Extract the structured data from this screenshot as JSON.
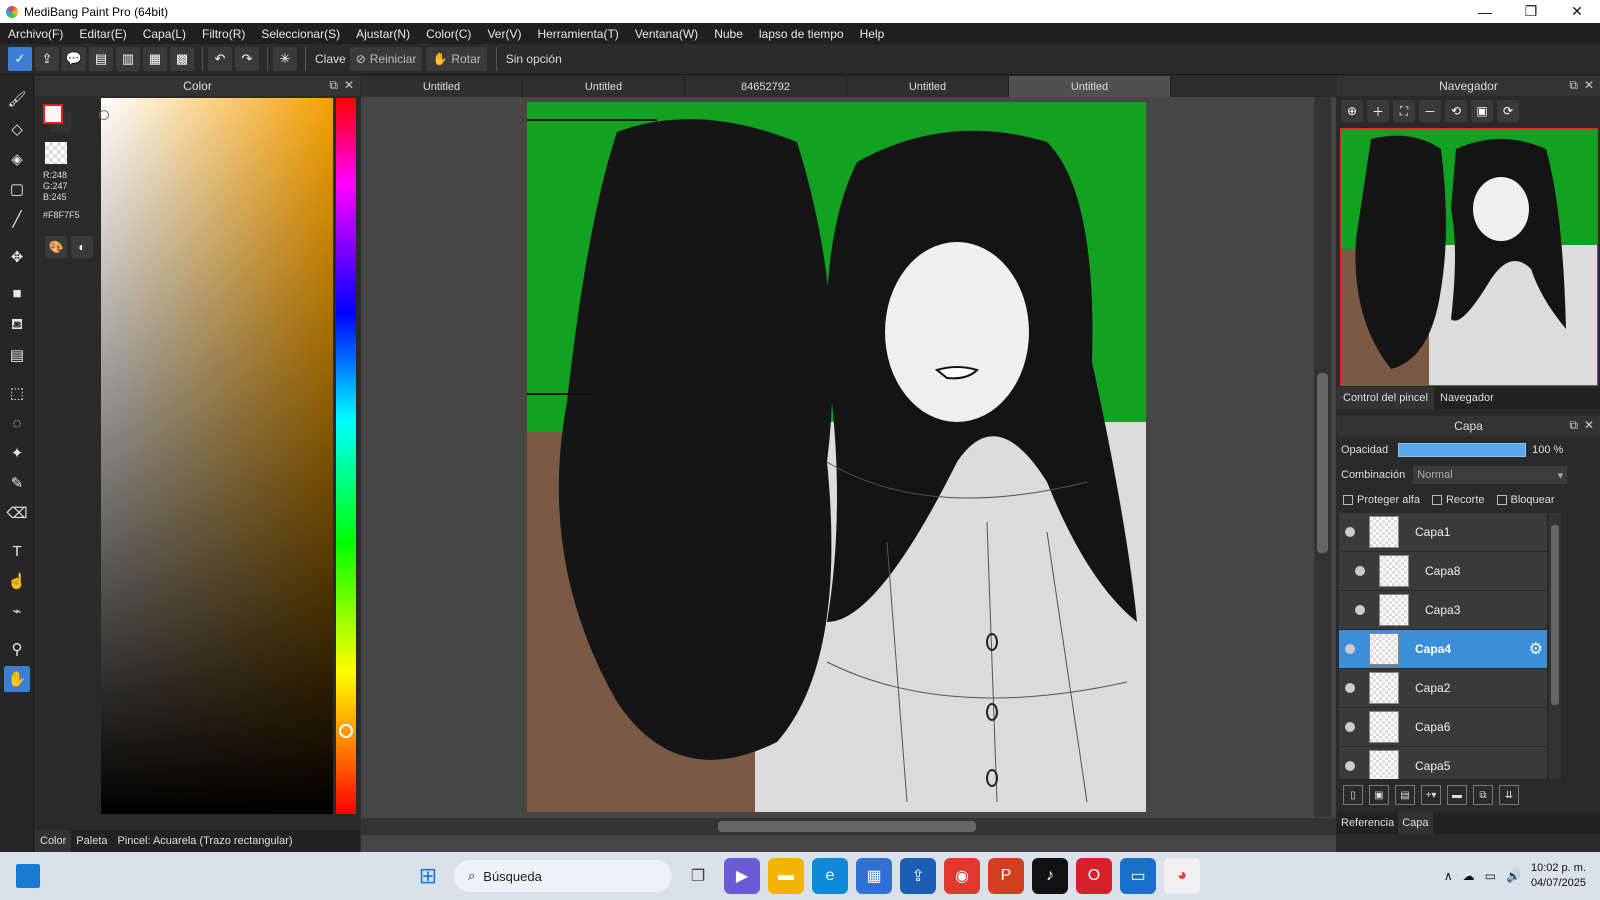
{
  "window": {
    "title": "MediBang Paint Pro (64bit)"
  },
  "menu": [
    "Archivo(F)",
    "Editar(E)",
    "Capa(L)",
    "Filtro(R)",
    "Seleccionar(S)",
    "Ajustar(N)",
    "Color(C)",
    "Ver(V)",
    "Herramienta(T)",
    "Ventana(W)",
    "Nube",
    "lapso de tiempo",
    "Help"
  ],
  "toolbar": {
    "clave": "Clave",
    "reiniciar": "Reiniciar",
    "rotar": "Rotar",
    "option": "Sin opción"
  },
  "color_panel": {
    "title": "Color",
    "r": "R:248",
    "g": "G:247",
    "b": "B:245",
    "hex": "#F8F7F5",
    "current_color": "#F8F7F5",
    "tabs": [
      "Color",
      "Paleta",
      "Pincel: Acuarela (Trazo rectangular)"
    ]
  },
  "documents": {
    "tabs": [
      "Untitled",
      "Untitled",
      "84652792",
      "Untitled",
      "Untitled"
    ],
    "active_index": 4
  },
  "navigator": {
    "title": "Navegador"
  },
  "right_tabs": [
    "Control del pincel",
    "Navegador"
  ],
  "layer_panel": {
    "title": "Capa",
    "opacity_label": "Opacidad",
    "opacity_value": "100 %",
    "opacity": 100,
    "blend_label": "Combinación",
    "blend_value": "Normal",
    "protect_alpha": "Proteger alfa",
    "clip": "Recorte",
    "lock": "Bloquear",
    "layers": [
      {
        "name": "Capa1",
        "selected": false,
        "indent": false
      },
      {
        "name": "Capa8",
        "selected": false,
        "indent": true
      },
      {
        "name": "Capa3",
        "selected": false,
        "indent": true
      },
      {
        "name": "Capa4",
        "selected": true,
        "indent": false
      },
      {
        "name": "Capa2",
        "selected": false,
        "indent": false
      },
      {
        "name": "Capa6",
        "selected": false,
        "indent": false
      },
      {
        "name": "Capa5",
        "selected": false,
        "indent": false
      }
    ]
  },
  "bottom_right_tabs": [
    "Referencia",
    "Capa"
  ],
  "taskbar": {
    "search_label": "Búsqueda",
    "time": "10:02 p. m.",
    "date": "04/07/2025"
  }
}
